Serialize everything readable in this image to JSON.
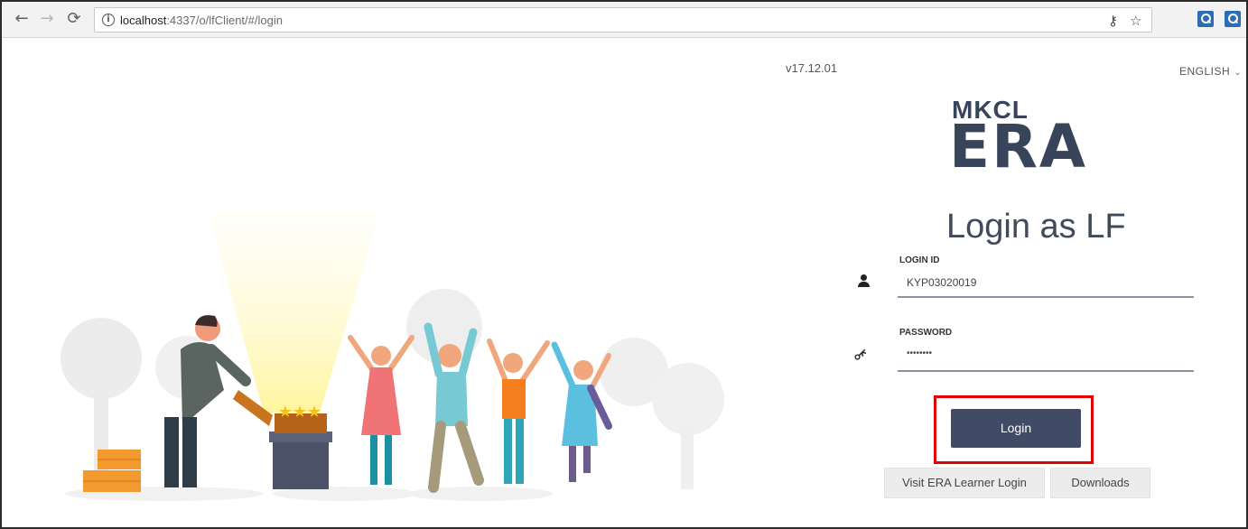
{
  "browser": {
    "url_host": "localhost",
    "url_rest": ":4337/o/lfClient/#/login",
    "back_icon": "arrow-left-icon",
    "forward_icon": "arrow-right-icon",
    "reload_icon": "reload-icon"
  },
  "header": {
    "version": "v17.12.01",
    "language": "ENGLISH"
  },
  "logo": {
    "line1": "MKCL",
    "line2": "ERA",
    "color": "#384459"
  },
  "form": {
    "title": "Login as LF",
    "login_id_label": "LOGIN ID",
    "login_id_value": "KYP03020019",
    "password_label": "PASSWORD",
    "password_value": "••••••••",
    "login_button": "Login",
    "learner_login_button": "Visit ERA Learner Login",
    "downloads_button": "Downloads"
  },
  "colors": {
    "primary_button": "#414b66",
    "highlight": "#e00000"
  }
}
